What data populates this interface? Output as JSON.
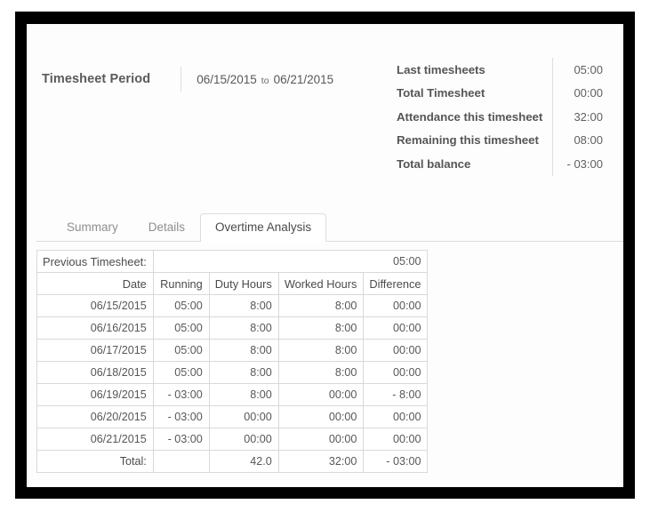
{
  "window": {
    "background_color": "#ffffff",
    "frame_color": "#000000",
    "panel_color": "#fdfdfd"
  },
  "period": {
    "label": "Timesheet Period",
    "start_date": "06/15/2015",
    "separator": "to",
    "end_date": "06/21/2015"
  },
  "stats": [
    {
      "label": "Last timesheets",
      "value": "05:00"
    },
    {
      "label": "Total Timesheet",
      "value": "00:00"
    },
    {
      "label": "Attendance this timesheet",
      "value": "32:00"
    },
    {
      "label": "Remaining this timesheet",
      "value": "08:00"
    },
    {
      "label": "Total balance",
      "value": "- 03:00"
    }
  ],
  "tabs": [
    {
      "label": "Summary",
      "active": false
    },
    {
      "label": "Details",
      "active": false
    },
    {
      "label": "Overtime Analysis",
      "active": true
    }
  ],
  "table": {
    "previous": {
      "label": "Previous Timesheet:",
      "value": "05:00"
    },
    "columns": [
      "Date",
      "Running",
      "Duty Hours",
      "Worked Hours",
      "Difference"
    ],
    "rows": [
      {
        "date": "06/15/2015",
        "running": "05:00",
        "duty": "8:00",
        "worked": "8:00",
        "difference": "00:00"
      },
      {
        "date": "06/16/2015",
        "running": "05:00",
        "duty": "8:00",
        "worked": "8:00",
        "difference": "00:00"
      },
      {
        "date": "06/17/2015",
        "running": "05:00",
        "duty": "8:00",
        "worked": "8:00",
        "difference": "00:00"
      },
      {
        "date": "06/18/2015",
        "running": "05:00",
        "duty": "8:00",
        "worked": "8:00",
        "difference": "00:00"
      },
      {
        "date": "06/19/2015",
        "running": "- 03:00",
        "duty": "8:00",
        "worked": "00:00",
        "difference": "- 8:00"
      },
      {
        "date": "06/20/2015",
        "running": "- 03:00",
        "duty": "00:00",
        "worked": "00:00",
        "difference": "00:00"
      },
      {
        "date": "06/21/2015",
        "running": "- 03:00",
        "duty": "00:00",
        "worked": "00:00",
        "difference": "00:00"
      }
    ],
    "total": {
      "label": "Total:",
      "running": "",
      "duty": "42.0",
      "worked": "32:00",
      "difference": "- 03:00"
    }
  }
}
